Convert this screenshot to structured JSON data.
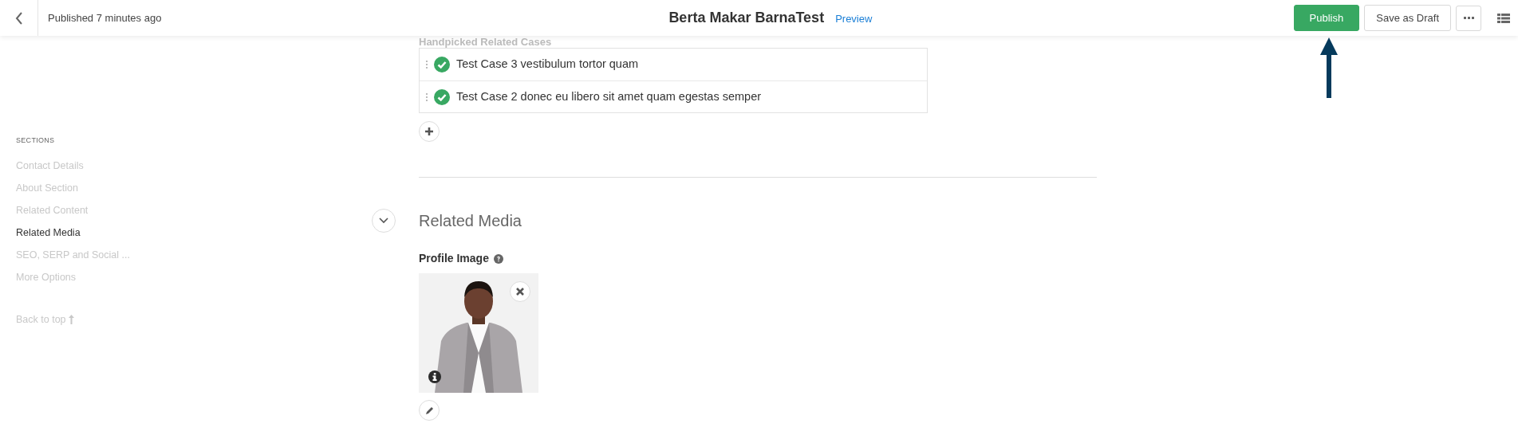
{
  "header": {
    "status": "Published 7 minutes ago",
    "title": "Berta Makar BarnaTest",
    "preview_link": "Preview",
    "buttons": [
      {
        "label": "Publish",
        "kind": "primary"
      },
      {
        "label": "Save as Draft",
        "kind": "secondary"
      }
    ]
  },
  "sidebar": {
    "heading": "SECTIONS",
    "items": [
      {
        "label": "Contact Details",
        "selected": false
      },
      {
        "label": "About Section",
        "selected": false
      },
      {
        "label": "Related Content",
        "selected": false
      },
      {
        "label": "Related Media",
        "selected": true
      },
      {
        "label": "SEO, SERP and Social ...",
        "selected": false
      },
      {
        "label": "More Options",
        "selected": false
      }
    ],
    "back_to_top": "Back to top"
  },
  "related_cases": {
    "heading": "Handpicked Related Cases",
    "items": [
      {
        "label": "Test Case 3 vestibulum tortor quam",
        "checked": true
      },
      {
        "label": "Test Case 2 donec eu libero sit amet quam egestas semper",
        "checked": true
      }
    ]
  },
  "related_media": {
    "title": "Related Media",
    "expanded": true,
    "profile_image": {
      "label": "Profile Image",
      "kind": "picture"
    }
  }
}
